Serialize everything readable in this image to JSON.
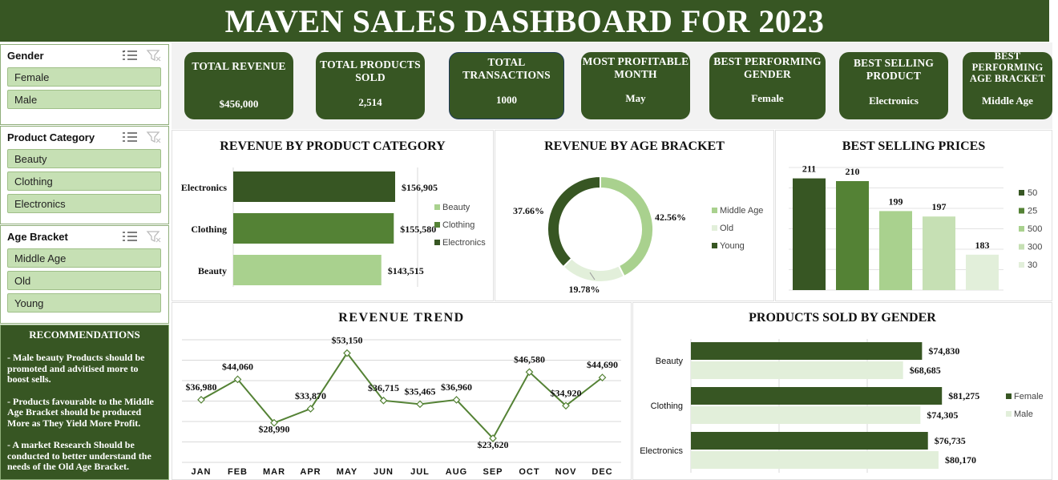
{
  "title": "MAVEN SALES DASHBOARD FOR 2023",
  "slicers": [
    {
      "title": "Gender",
      "items": [
        "Female",
        "Male"
      ]
    },
    {
      "title": "Product Category",
      "items": [
        "Beauty",
        "Clothing",
        "Electronics"
      ]
    },
    {
      "title": "Age Bracket",
      "items": [
        "Middle Age",
        "Old",
        "Young"
      ]
    }
  ],
  "recommendations": {
    "title": "RECOMMENDATIONS",
    "items": [
      "- Male beauty Products should be promoted and advitised more to boost sells.",
      "- Products favourable to the Middle Age Bracket should be produced More as They Yield More Profit.",
      "- A market Research Should be conducted to better understand the needs of the Old Age Bracket."
    ]
  },
  "kpis": [
    {
      "title": "TOTAL REVENUE",
      "value": "$456,000"
    },
    {
      "title": "TOTAL PRODUCTS SOLD",
      "value": "2,514"
    },
    {
      "title": "TOTAL TRANSACTIONS",
      "value": "1000"
    },
    {
      "title": "MOST PROFITABLE MONTH",
      "value": "May"
    },
    {
      "title": "BEST PERFORMING GENDER",
      "value": "Female"
    },
    {
      "title": "BEST SELLING PRODUCT",
      "value": "Electronics"
    },
    {
      "title": "BEST PERFORMING AGE BRACKET",
      "value": "Middle Age"
    }
  ],
  "colors": {
    "dark": "#375623",
    "mid": "#548235",
    "light": "#a9d18e",
    "pale": "#e2efda"
  },
  "chart_data": [
    {
      "type": "bar",
      "title": "REVENUE BY PRODUCT CATEGORY",
      "categories": [
        "Electronics",
        "Clothing",
        "Beauty"
      ],
      "values": [
        156905,
        155580,
        143515
      ],
      "labels": [
        "$156,905",
        "$155,580",
        "$143,515"
      ],
      "legend": [
        "Beauty",
        "Clothing",
        "Electronics"
      ],
      "legend_position": "right"
    },
    {
      "type": "pie",
      "title": "REVENUE BY AGE BRACKET",
      "categories": [
        "Middle Age",
        "Old",
        "Young"
      ],
      "values": [
        42.56,
        19.78,
        37.66
      ],
      "labels": [
        "42.56%",
        "19.78%",
        "37.66%"
      ],
      "legend_position": "right"
    },
    {
      "type": "bar",
      "title": "BEST SELLING PRICES",
      "categories": [
        "50",
        "25",
        "500",
        "300",
        "30"
      ],
      "values": [
        211,
        210,
        199,
        197,
        183
      ],
      "labels": [
        "211",
        "210",
        "199",
        "197",
        "183"
      ],
      "legend": [
        "50",
        "25",
        "500",
        "300",
        "30"
      ],
      "legend_position": "right",
      "grid": true
    },
    {
      "type": "line",
      "title": "REVENUE TREND",
      "x": [
        "JAN",
        "FEB",
        "MAR",
        "APR",
        "MAY",
        "JUN",
        "JUL",
        "AUG",
        "SEP",
        "OCT",
        "NOV",
        "DEC"
      ],
      "values": [
        36980,
        44060,
        28990,
        33870,
        53150,
        36715,
        35465,
        36960,
        23620,
        46580,
        34920,
        44690
      ],
      "labels": [
        "$36,980",
        "$44,060",
        "$28,990",
        "$33,870",
        "$53,150",
        "$36,715",
        "$35,465",
        "$36,960",
        "$23,620",
        "$46,580",
        "$34,920",
        "$44,690"
      ],
      "grid": true
    },
    {
      "type": "bar",
      "title": "PRODUCTS SOLD BY GENDER",
      "categories": [
        "Beauty",
        "Clothing",
        "Electronics"
      ],
      "series": [
        {
          "name": "Female",
          "values": [
            74830,
            81275,
            76735
          ],
          "labels": [
            "$74,830",
            "$81,275",
            "$76,735"
          ]
        },
        {
          "name": "Male",
          "values": [
            68685,
            74305,
            80170
          ],
          "labels": [
            "$68,685",
            "$74,305",
            "$80,170"
          ]
        }
      ],
      "legend_position": "right",
      "grid": true
    }
  ]
}
